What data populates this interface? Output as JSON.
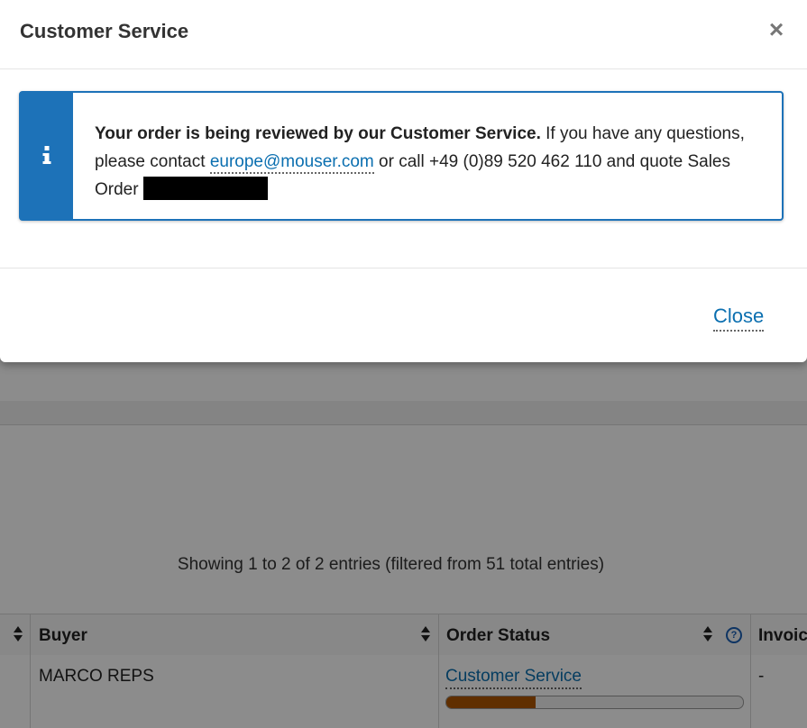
{
  "modal": {
    "title": "Customer Service",
    "close_icon": "close-icon",
    "alert": {
      "icon": "info-icon",
      "bold_text": "Your order is being reviewed by our Customer Service.",
      "text_before_email": " If you have any questions, please contact ",
      "email": "europe@mouser.com",
      "text_after_email": " or call +49 (0)89 520 462 110 and quote Sales Order ",
      "accent_color": "#1d72b8"
    },
    "footer": {
      "close_label": "Close"
    }
  },
  "background": {
    "table_info": "Showing 1 to 2 of 2 entries (filtered from 51 total entries)",
    "headers": {
      "buyer": "Buyer",
      "order_status": "Order Status",
      "invoice": "Invoic"
    },
    "row": {
      "buyer": "MARCO REPS",
      "order_status": "Customer Service",
      "progress": 0.3,
      "invoice": "-"
    },
    "progress_color": "#b05600"
  }
}
